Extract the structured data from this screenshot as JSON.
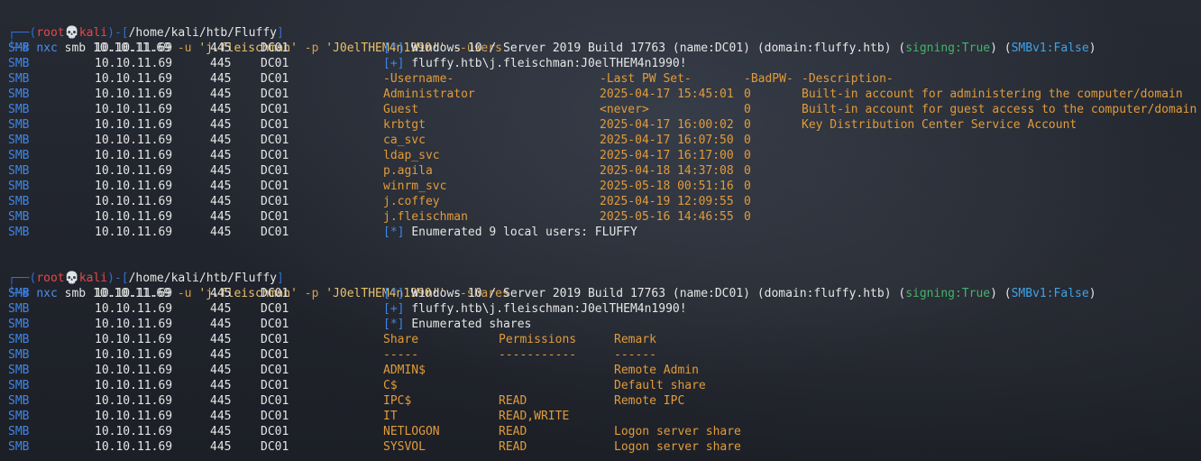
{
  "prompt": {
    "user": "root",
    "skull": "💀",
    "host": "kali",
    "path": "/home/kali/htb/Fluffy"
  },
  "cmd1": {
    "tool": "nxc",
    "protocol": "smb",
    "target": "10.10.11.69",
    "user_flag": "-u",
    "user_val": "'j.fleischman'",
    "pass_flag": "-p",
    "pass_val": "'J0elTHEM4n1990!'",
    "action": "--users"
  },
  "cmd2": {
    "tool": "nxc",
    "protocol": "smb",
    "target": "10.10.11.69",
    "user_flag": "-u",
    "user_val": "'j.fleischman'",
    "pass_flag": "-p",
    "pass_val": "'J0elTHEM4n1990!'",
    "action": "--shares"
  },
  "common": {
    "proto": "SMB",
    "ip": "10.10.11.69",
    "port": "445",
    "host": "DC01"
  },
  "info": {
    "star_tag": "[*]",
    "plus_tag": "[+]",
    "os_text": "Windows 10 / Server 2019 Build 17763 (name:DC01) (domain:fluffy.htb) (",
    "signing": "signing:True",
    "mid": ") (",
    "smbv1": "SMBv1:False",
    "close": ")",
    "auth": "fluffy.htb\\j.fleischman:J0elTHEM4n1990!",
    "enum_users": "Enumerated 9 local users: FLUFFY",
    "enum_shares": "Enumerated shares"
  },
  "users_header": {
    "username": "-Username-",
    "last_pw": "-Last PW Set-",
    "badpw": "-BadPW-",
    "description": "-Description-"
  },
  "users": [
    {
      "name": "Administrator",
      "last": "2025-04-17 15:45:01",
      "bad": "0",
      "desc": "Built-in account for administering the computer/domain"
    },
    {
      "name": "Guest",
      "last": "<never>",
      "bad": "0",
      "desc": "Built-in account for guest access to the computer/domain"
    },
    {
      "name": "krbtgt",
      "last": "2025-04-17 16:00:02",
      "bad": "0",
      "desc": "Key Distribution Center Service Account"
    },
    {
      "name": "ca_svc",
      "last": "2025-04-17 16:07:50",
      "bad": "0",
      "desc": ""
    },
    {
      "name": "ldap_svc",
      "last": "2025-04-17 16:17:00",
      "bad": "0",
      "desc": ""
    },
    {
      "name": "p.agila",
      "last": "2025-04-18 14:37:08",
      "bad": "0",
      "desc": ""
    },
    {
      "name": "winrm_svc",
      "last": "2025-05-18 00:51:16",
      "bad": "0",
      "desc": ""
    },
    {
      "name": "j.coffey",
      "last": "2025-04-19 12:09:55",
      "bad": "0",
      "desc": ""
    },
    {
      "name": "j.fleischman",
      "last": "2025-05-16 14:46:55",
      "bad": "0",
      "desc": ""
    }
  ],
  "shares_header": {
    "share": "Share",
    "perms": "Permissions",
    "remark": "Remark",
    "share_sep": "-----",
    "perms_sep": "-----------",
    "remark_sep": "------"
  },
  "shares": [
    {
      "name": "ADMIN$",
      "perms": "",
      "remark": "Remote Admin"
    },
    {
      "name": "C$",
      "perms": "",
      "remark": "Default share"
    },
    {
      "name": "IPC$",
      "perms": "READ",
      "remark": "Remote IPC"
    },
    {
      "name": "IT",
      "perms": "READ,WRITE",
      "remark": ""
    },
    {
      "name": "NETLOGON",
      "perms": "READ",
      "remark": "Logon server share"
    },
    {
      "name": "SYSVOL",
      "perms": "READ",
      "remark": "Logon server share"
    }
  ]
}
